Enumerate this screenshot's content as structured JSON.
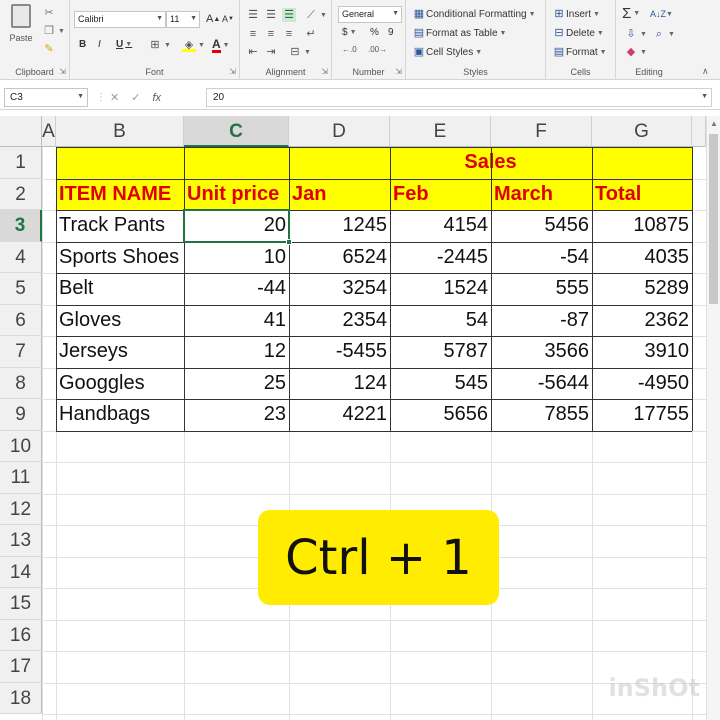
{
  "ribbon": {
    "clipboard": {
      "paste_label": "Paste",
      "group_label": "Clipboard"
    },
    "font": {
      "font_name": "Calibri",
      "font_size": "11",
      "bold": "B",
      "italic": "I",
      "underline": "U",
      "grow": "A",
      "shrink": "A",
      "font_color_letter": "A",
      "group_label": "Font"
    },
    "alignment": {
      "group_label": "Alignment"
    },
    "number": {
      "format": "General",
      "currency": "$",
      "percent": "%",
      "comma": "9",
      "group_label": "Number"
    },
    "styles": {
      "conditional": "Conditional Formatting",
      "format_table": "Format as Table",
      "cell_styles": "Cell Styles",
      "group_label": "Styles"
    },
    "cells": {
      "insert": "Insert",
      "delete": "Delete",
      "format": "Format",
      "group_label": "Cells"
    },
    "editing": {
      "sum": "Σ",
      "group_label": "Editing"
    }
  },
  "formula_bar": {
    "name_box": "C3",
    "fx": "fx",
    "cancel": "✕",
    "enter": "✓",
    "value": "20"
  },
  "columns": [
    "A",
    "B",
    "C",
    "D",
    "E",
    "F",
    "G"
  ],
  "rows": [
    "1",
    "2",
    "3",
    "4",
    "5",
    "6",
    "7",
    "8",
    "9",
    "10",
    "11",
    "12",
    "13",
    "14",
    "15",
    "16",
    "17",
    "18"
  ],
  "table": {
    "sales_header": "Sales",
    "headers": [
      "ITEM NAME",
      "Unit price",
      "Jan",
      "Feb",
      "March",
      "Total"
    ],
    "data": [
      [
        "Track Pants",
        "20",
        "1245",
        "4154",
        "5456",
        "10875"
      ],
      [
        "Sports Shoes",
        "10",
        "6524",
        "-2445",
        "-54",
        "4035"
      ],
      [
        "Belt",
        "-44",
        "3254",
        "1524",
        "555",
        "5289"
      ],
      [
        "Gloves",
        "41",
        "2354",
        "54",
        "-87",
        "2362"
      ],
      [
        "Jerseys",
        "12",
        "-5455",
        "5787",
        "3566",
        "3910"
      ],
      [
        "Googgles",
        "25",
        "124",
        "545",
        "-5644",
        "-4950"
      ],
      [
        "Handbags",
        "23",
        "4221",
        "5656",
        "7855",
        "17755"
      ]
    ]
  },
  "overlay": {
    "shortcut": "Ctrl + 1",
    "watermark": "inShOt"
  },
  "colors": {
    "highlight": "#ffff00",
    "header_text": "#e00000",
    "selection": "#217346",
    "overlay_bg": "#ffec00"
  }
}
